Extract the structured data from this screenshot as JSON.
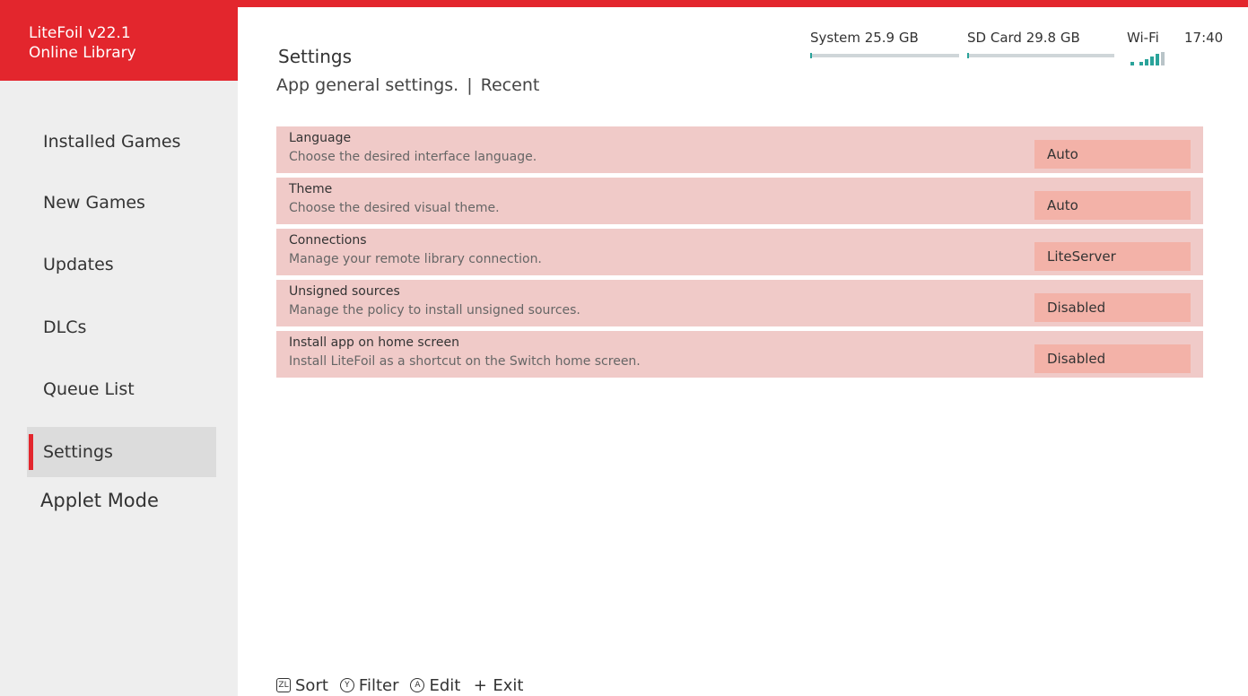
{
  "app": {
    "title": "LiteFoil v22.1",
    "subtitle": "Online Library"
  },
  "sidebar": {
    "items": [
      {
        "label": "Installed Games",
        "active": false
      },
      {
        "label": "New Games",
        "active": false
      },
      {
        "label": "Updates",
        "active": false
      },
      {
        "label": "DLCs",
        "active": false
      },
      {
        "label": "Queue List",
        "active": false
      },
      {
        "label": "Settings",
        "active": true
      }
    ],
    "applet_mode": "Applet Mode"
  },
  "header": {
    "title": "Settings",
    "subtitle": "App general settings.",
    "separator": "|",
    "recent": "Recent"
  },
  "status": {
    "system": {
      "label": "System 25.9 GB",
      "used_fraction": 0.0
    },
    "sd_card": {
      "label": "SD Card 29.8 GB",
      "used_fraction": 0.01
    },
    "wifi_label": "Wi-Fi",
    "wifi_icon": "wifi-signal-icon",
    "wifi_bars": 3,
    "clock": "17:40"
  },
  "settings": [
    {
      "name": "Language",
      "description": "Choose the desired interface language.",
      "value": "Auto"
    },
    {
      "name": "Theme",
      "description": "Choose the desired visual theme.",
      "value": "Auto"
    },
    {
      "name": "Connections",
      "description": "Manage your remote library connection.",
      "value": "LiteServer"
    },
    {
      "name": "Unsigned sources",
      "description": "Manage the policy to install unsigned sources.",
      "value": "Disabled"
    },
    {
      "name": "Install app on home screen",
      "description": "Install LiteFoil as a shortcut on the Switch home screen.",
      "value": "Disabled"
    }
  ],
  "footer": {
    "hints": [
      {
        "button": "ZL",
        "icon": "zl-button-icon",
        "label": "Sort"
      },
      {
        "button": "Y",
        "icon": "y-button-icon",
        "label": "Filter"
      },
      {
        "button": "A",
        "icon": "a-button-icon",
        "label": "Edit"
      },
      {
        "button": "+",
        "icon": "plus-button-icon",
        "label": "Exit"
      }
    ]
  },
  "colors": {
    "accent": "#e3262d",
    "row_bg": "#f0cac8",
    "value_bg": "#f3b2a8",
    "storage_fill": "#2aa39a"
  }
}
